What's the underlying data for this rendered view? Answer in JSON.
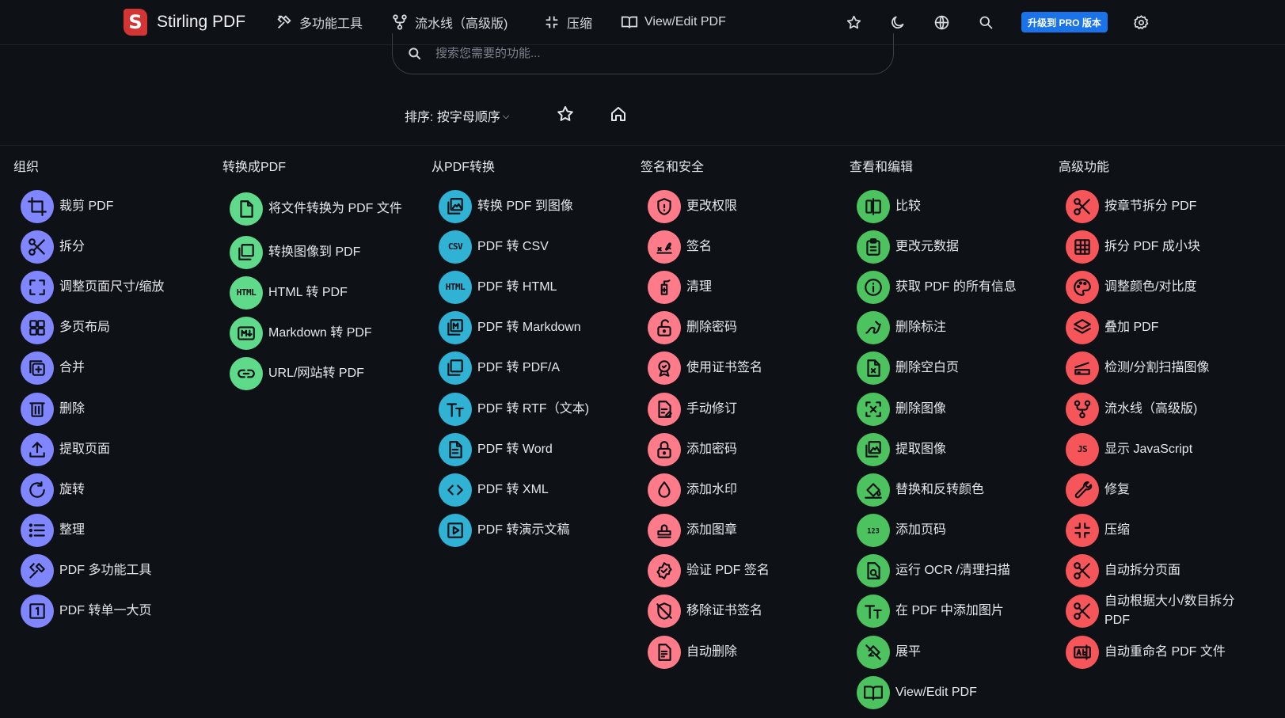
{
  "brand": {
    "logo_letter": "S",
    "name": "Stirling PDF"
  },
  "nav": {
    "multi_tool": "多功能工具",
    "pipeline": "流水线（高级版)",
    "compress": "压缩",
    "view_edit": "View/Edit PDF",
    "pro_button": "升级到 PRO 版本"
  },
  "search": {
    "placeholder": "搜索您需要的功能..."
  },
  "sort": {
    "label": "排序: 按字母顺序"
  },
  "columns": [
    {
      "title": "组织",
      "tools": [
        {
          "label": "裁剪 PDF",
          "icon": "crop-icon"
        },
        {
          "label": "拆分",
          "icon": "scissors-icon"
        },
        {
          "label": "调整页面尺寸/缩放",
          "icon": "resize-icon"
        },
        {
          "label": "多页布局",
          "icon": "grid-icon"
        },
        {
          "label": "合并",
          "icon": "merge-icon"
        },
        {
          "label": "删除",
          "icon": "trash-icon"
        },
        {
          "label": "提取页面",
          "icon": "upload-icon"
        },
        {
          "label": "旋转",
          "icon": "rotate-icon"
        },
        {
          "label": "整理",
          "icon": "list-icon"
        },
        {
          "label": "PDF 多功能工具",
          "icon": "tools-icon"
        },
        {
          "label": "PDF 转单一大页",
          "icon": "single-page-icon"
        }
      ]
    },
    {
      "title": "转换成PDF",
      "tools": [
        {
          "label": "将文件转换为 PDF 文件",
          "icon": "file-icon"
        },
        {
          "label": "转换图像到 PDF",
          "icon": "pdf-image-icon"
        },
        {
          "label": "HTML 转 PDF",
          "icon": "html-icon"
        },
        {
          "label": "Markdown 转 PDF",
          "icon": "markdown-icon"
        },
        {
          "label": "URL/网站转 PDF",
          "icon": "link-icon"
        }
      ]
    },
    {
      "title": "从PDF转换",
      "tools": [
        {
          "label": "转换 PDF 到图像",
          "icon": "image-icon"
        },
        {
          "label": "PDF 转 CSV",
          "icon": "csv-icon"
        },
        {
          "label": "PDF 转 HTML",
          "icon": "html-icon"
        },
        {
          "label": "PDF 转 Markdown",
          "icon": "markdown-doc-icon"
        },
        {
          "label": "PDF 转 PDF/A",
          "icon": "pdfa-icon"
        },
        {
          "label": "PDF 转 RTF（文本)",
          "icon": "text-icon"
        },
        {
          "label": "PDF 转 Word",
          "icon": "word-doc-icon"
        },
        {
          "label": "PDF 转 XML",
          "icon": "code-icon"
        },
        {
          "label": "PDF 转演示文稿",
          "icon": "play-icon"
        }
      ]
    },
    {
      "title": "签名和安全",
      "tools": [
        {
          "label": "更改权限",
          "icon": "shield-icon"
        },
        {
          "label": "签名",
          "icon": "signature-icon"
        },
        {
          "label": "清理",
          "icon": "sanitize-icon"
        },
        {
          "label": "删除密码",
          "icon": "unlock-icon"
        },
        {
          "label": "使用证书签名",
          "icon": "certificate-icon"
        },
        {
          "label": "手动修订",
          "icon": "redact-icon"
        },
        {
          "label": "添加密码",
          "icon": "lock-icon"
        },
        {
          "label": "添加水印",
          "icon": "drop-icon"
        },
        {
          "label": "添加图章",
          "icon": "stamp-icon"
        },
        {
          "label": "验证 PDF 签名",
          "icon": "verified-icon"
        },
        {
          "label": "移除证书签名",
          "icon": "remove-cert-icon"
        },
        {
          "label": "自动删除",
          "icon": "auto-redact-icon"
        }
      ]
    },
    {
      "title": "查看和编辑",
      "tools": [
        {
          "label": "比较",
          "icon": "compare-icon"
        },
        {
          "label": "更改元数据",
          "icon": "clipboard-icon"
        },
        {
          "label": "获取 PDF 的所有信息",
          "icon": "info-icon"
        },
        {
          "label": "删除标注",
          "icon": "annotation-icon"
        },
        {
          "label": "删除空白页",
          "icon": "blank-page-icon"
        },
        {
          "label": "删除图像",
          "icon": "remove-image-icon"
        },
        {
          "label": "提取图像",
          "icon": "image-icon"
        },
        {
          "label": "替换和反转颜色",
          "icon": "paint-bucket-icon"
        },
        {
          "label": "添加页码",
          "icon": "numbers-icon"
        },
        {
          "label": "运行 OCR /清理扫描",
          "icon": "ocr-icon"
        },
        {
          "label": "在 PDF 中添加图片",
          "icon": "text-icon"
        },
        {
          "label": "展平",
          "icon": "flatten-icon"
        },
        {
          "label": "View/Edit PDF",
          "icon": "book-icon"
        }
      ]
    },
    {
      "title": "高级功能",
      "tools": [
        {
          "label": "按章节拆分 PDF",
          "icon": "scissors-icon"
        },
        {
          "label": "拆分 PDF 成小块",
          "icon": "grid-split-icon"
        },
        {
          "label": "调整颜色/对比度",
          "icon": "palette-icon"
        },
        {
          "label": "叠加 PDF",
          "icon": "layers-icon"
        },
        {
          "label": "检测/分割扫描图像",
          "icon": "scanner-icon"
        },
        {
          "label": "流水线（高级版)",
          "icon": "pipeline-icon"
        },
        {
          "label": "显示 JavaScript",
          "icon": "js-icon"
        },
        {
          "label": "修复",
          "icon": "wrench-icon"
        },
        {
          "label": "压缩",
          "icon": "compress-icon"
        },
        {
          "label": "自动拆分页面",
          "icon": "scissors-icon"
        },
        {
          "label": "自动根据大小/数目拆分 PDF",
          "icon": "scissors-icon"
        },
        {
          "label": "自动重命名 PDF 文件",
          "icon": "rename-icon"
        }
      ]
    }
  ]
}
